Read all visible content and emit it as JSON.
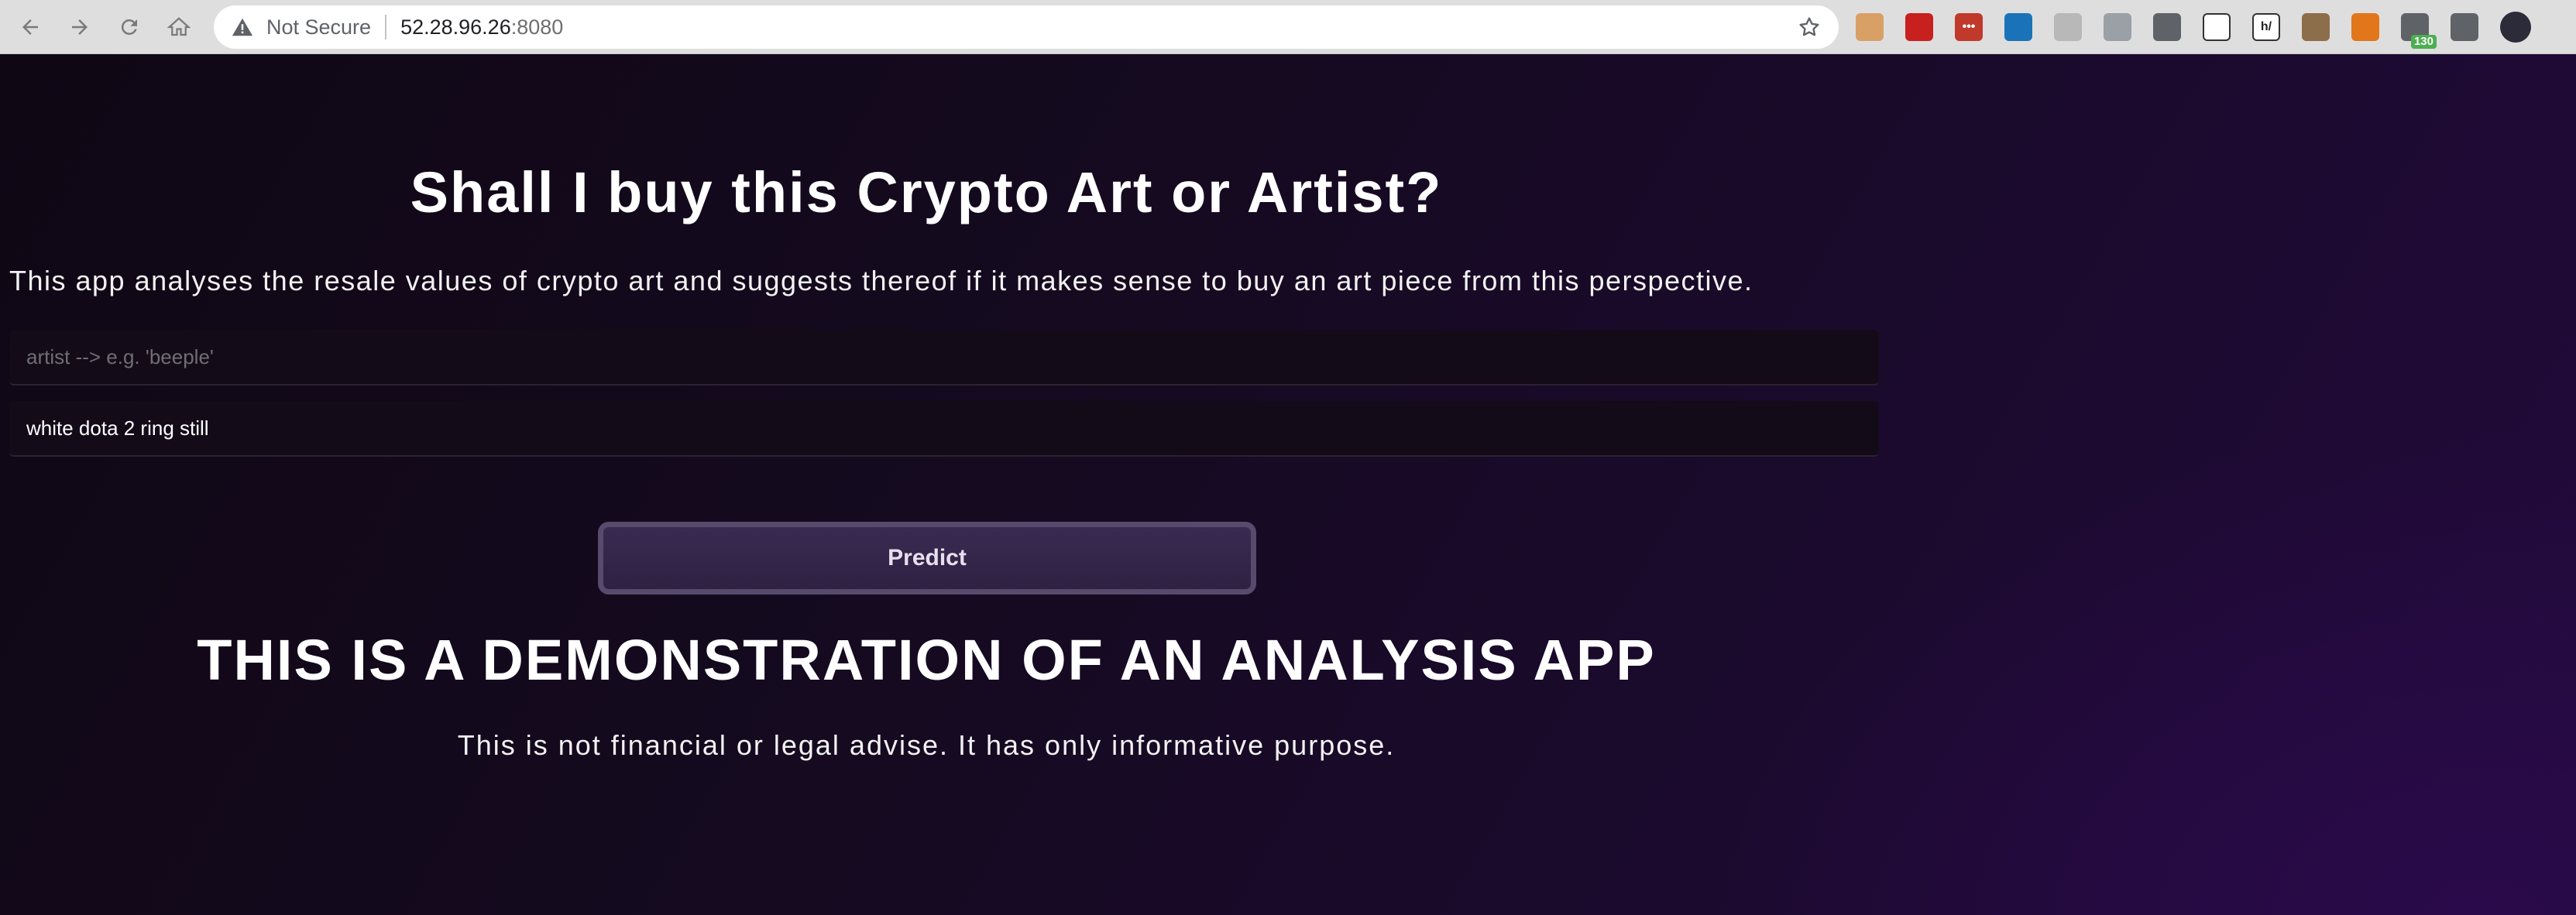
{
  "browser": {
    "omnibox": {
      "security_label": "Not Secure",
      "url_host": "52.28.96.26",
      "url_port": ":8080"
    },
    "extensions": [
      {
        "name": "cookie-extension-icon",
        "color": "#d9a066",
        "label": ""
      },
      {
        "name": "ublock-extension-icon",
        "color": "#c8201f",
        "label": ""
      },
      {
        "name": "lastpass-extension-icon",
        "color": "#c0392b",
        "label": "•••"
      },
      {
        "name": "timer-extension-icon",
        "color": "#1a73b8",
        "label": ""
      },
      {
        "name": "wand-extension-icon",
        "color": "#b8b8b8",
        "label": ""
      },
      {
        "name": "printer-extension-icon",
        "color": "#9aa0a6",
        "label": ""
      },
      {
        "name": "eyedropper-extension-icon",
        "color": "#5f6368",
        "label": ""
      },
      {
        "name": "dev-extension-icon",
        "color": "#ffffff",
        "label": ""
      },
      {
        "name": "hypothesis-extension-icon",
        "color": "#ffffff",
        "label": "h/"
      },
      {
        "name": "cookie-editor-extension-icon",
        "color": "#8d6e4a",
        "label": ""
      },
      {
        "name": "metamask-extension-icon",
        "color": "#e2761b",
        "label": ""
      },
      {
        "name": "vpn-extension-icon",
        "color": "#5f6368",
        "label": "",
        "badge": "130"
      },
      {
        "name": "puzzle-extension-icon",
        "color": "#5f6368",
        "label": ""
      },
      {
        "name": "profile-avatar",
        "color": "#2b2b3a",
        "label": ""
      }
    ]
  },
  "app": {
    "title": "Shall I buy this Crypto Art or Artist?",
    "description": "This app analyses the resale values of crypto art and suggests thereof if it makes sense to buy an art piece from this perspective.",
    "artist_input": {
      "placeholder": "artist --> e.g. 'beeple'",
      "value": ""
    },
    "art_input": {
      "placeholder": "",
      "value": "white dota 2 ring still"
    },
    "predict_label": "Predict",
    "demo_heading": "THIS IS A DEMONSTRATION OF AN ANALYSIS APP",
    "disclaimer": "This is not financial or legal advise. It has only informative purpose."
  },
  "colors": {
    "background": "#150a20",
    "button_border": "#584a6c",
    "button_fill": "#3a2a52",
    "text": "#ffffff"
  }
}
